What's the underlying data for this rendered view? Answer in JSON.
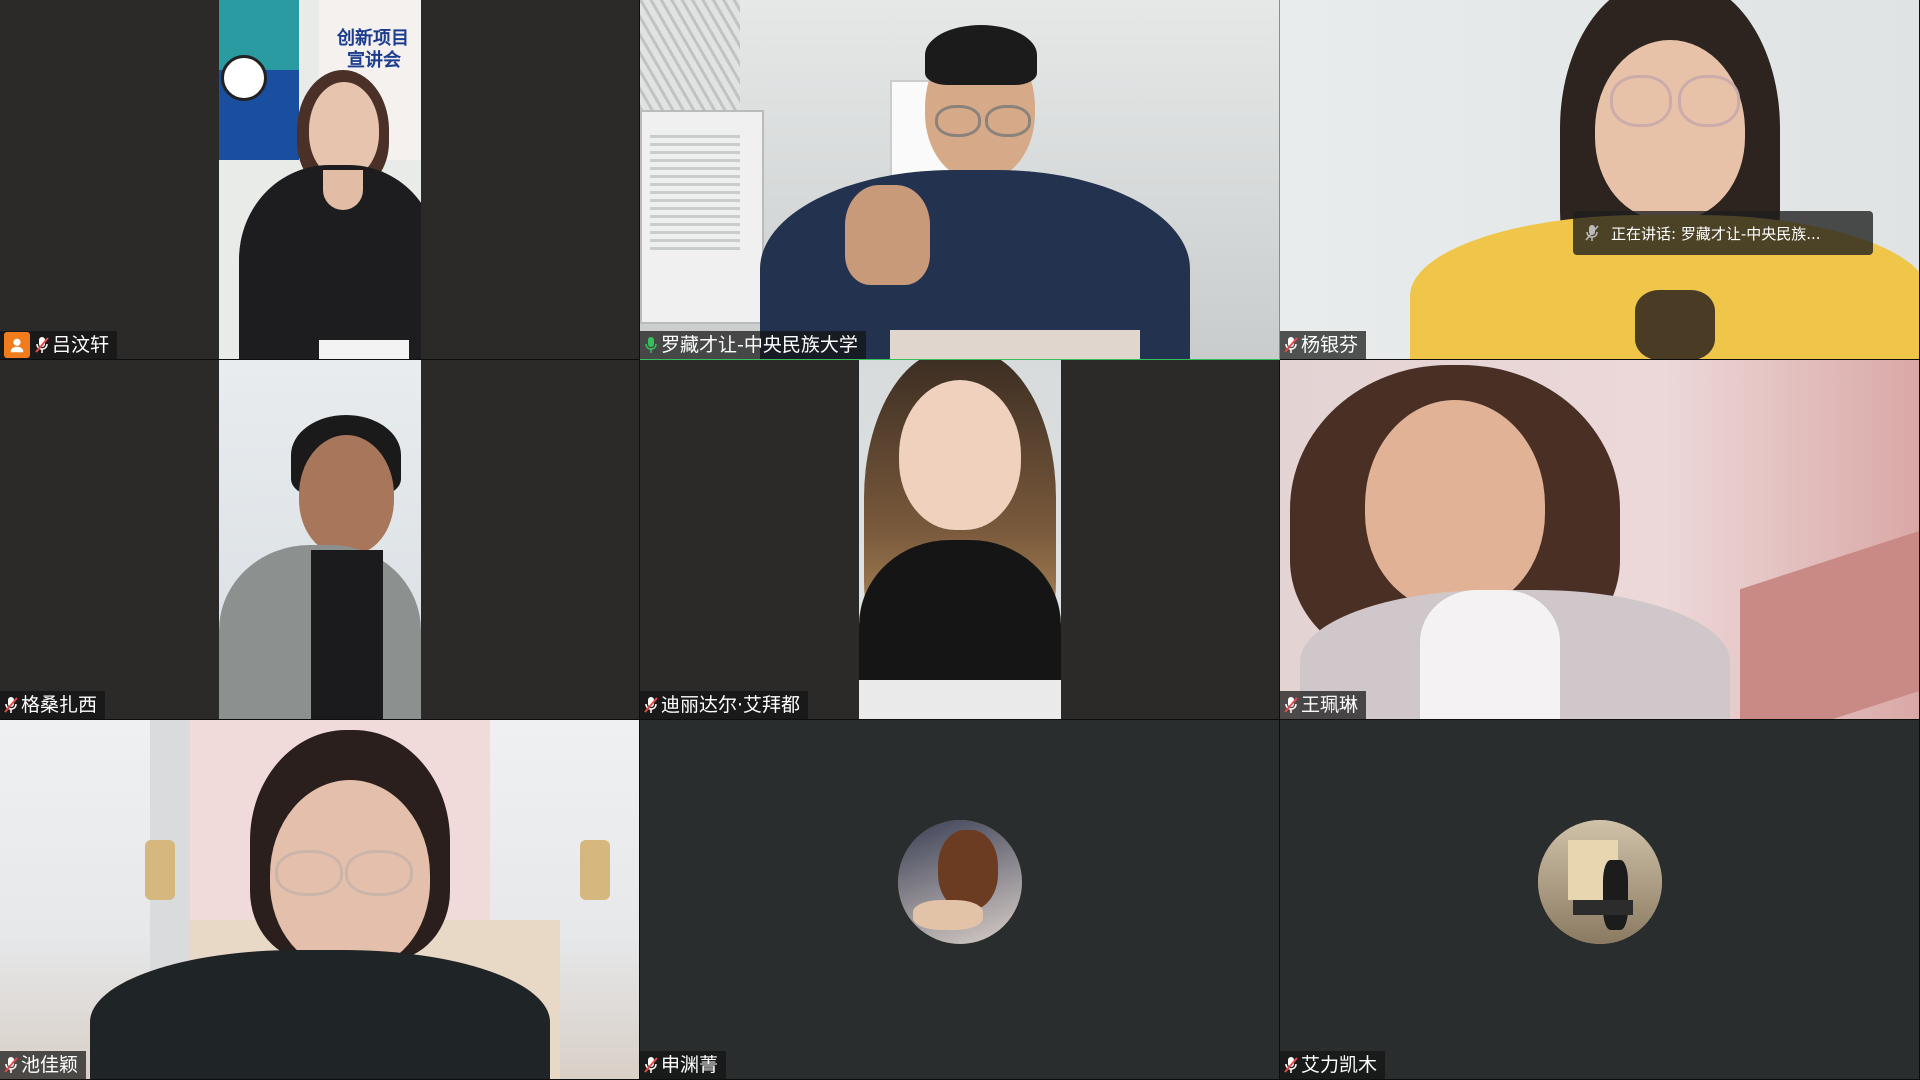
{
  "meeting": {
    "speaking_indicator": {
      "prefix": "正在讲话: ",
      "name": "罗藏才让-中央民族..."
    }
  },
  "participants": [
    {
      "name": "吕汶轩",
      "mic": "muted",
      "has_badge": true
    },
    {
      "name": "罗藏才让-中央民族大学",
      "mic": "active",
      "has_badge": false
    },
    {
      "name": "杨银芬",
      "mic": "muted",
      "has_badge": false
    },
    {
      "name": "格桑扎西",
      "mic": "muted",
      "has_badge": false
    },
    {
      "name": "迪丽达尔·艾拜都",
      "mic": "muted",
      "has_badge": false
    },
    {
      "name": "王珮琳",
      "mic": "muted",
      "has_badge": false
    },
    {
      "name": "池佳颖",
      "mic": "muted",
      "has_badge": false
    },
    {
      "name": "申渊菁",
      "mic": "muted",
      "has_badge": false,
      "video": "off"
    },
    {
      "name": "艾力凯木",
      "mic": "muted",
      "has_badge": false,
      "video": "off"
    }
  ],
  "poster_text": {
    "line1": "创新项目",
    "line2": "宣讲会"
  },
  "colors": {
    "active_border": "#35c25a",
    "badge": "#f07c1b",
    "muted_mic": "#e44b4b",
    "active_mic": "#35c25a"
  }
}
